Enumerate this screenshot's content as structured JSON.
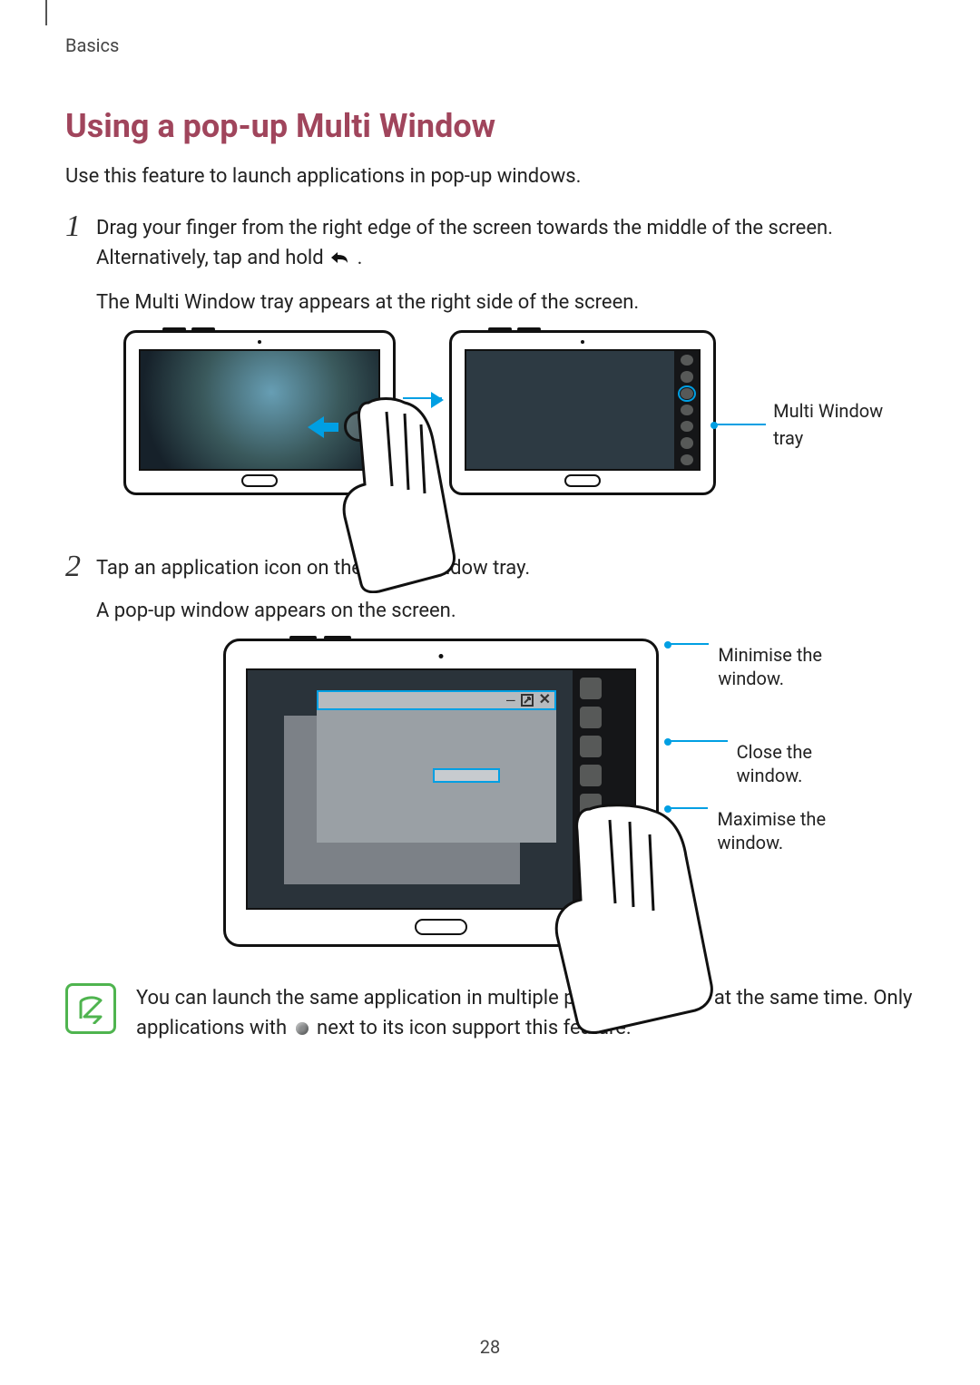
{
  "breadcrumb": "Basics",
  "title": "Using a pop-up Multi Window",
  "intro": "Use this feature to launch applications in pop-up windows.",
  "steps": {
    "s1": {
      "p1a": "Drag your finger from the right edge of the screen towards the middle of the screen. Alternatively, tap and hold ",
      "p1b": ".",
      "p2": "The Multi Window tray appears at the right side of the screen."
    },
    "s2": {
      "p1": "Tap an application icon on the Multi Window tray.",
      "p2": "A pop-up window appears on the screen."
    }
  },
  "callouts": {
    "tray": "Multi Window tray",
    "minimise": "Minimise the window.",
    "close": "Close the window.",
    "maximise": "Maximise the window."
  },
  "note": {
    "line1": "You can launch the same application in multiple pop-up windows at the same time. Only applications with ",
    "line2": " next to its icon support this feature."
  },
  "page_number": "28"
}
